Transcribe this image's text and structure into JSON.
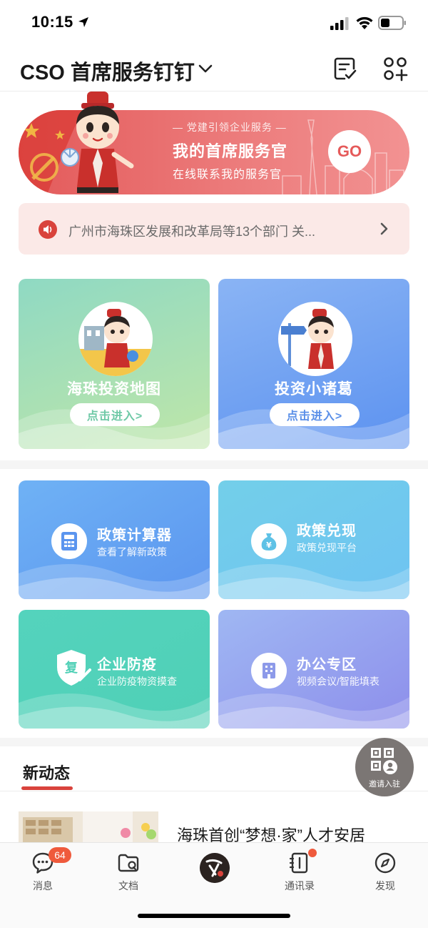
{
  "status_bar": {
    "time": "10:15"
  },
  "header": {
    "org_name": "CSO 首席服务钉钉"
  },
  "banner": {
    "subtitle": "— 党建引领企业服务 —",
    "title": "我的首席服务官",
    "description": "在线联系我的服务官",
    "go_label": "GO"
  },
  "notice": {
    "text": "广州市海珠区发展和改革局等13个部门 关..."
  },
  "feature_cards": [
    {
      "title": "海珠投资地图",
      "button": "点击进入>"
    },
    {
      "title": "投资小诸葛",
      "button": "点击进入>"
    }
  ],
  "service_cards": [
    {
      "title": "政策计算器",
      "subtitle": "查看了解新政策",
      "icon": "calculator-icon"
    },
    {
      "title": "政策兑现",
      "subtitle": "政策兑现平台",
      "icon": "money-bag-icon"
    },
    {
      "title": "企业防疫",
      "subtitle": "企业防疫物资摸查",
      "icon": "shield-icon",
      "icon_text": "复"
    },
    {
      "title": "办公专区",
      "subtitle": "视频会议/智能填表",
      "icon": "building-icon"
    }
  ],
  "news": {
    "tab": "新动态",
    "items": [
      {
        "title": "海珠首创“梦想·家”人才安居"
      }
    ]
  },
  "invite": {
    "label": "邀请入驻"
  },
  "tab_bar": {
    "items": [
      {
        "label": "消息",
        "badge": "64",
        "icon": "chat-icon"
      },
      {
        "label": "文档",
        "icon": "folder-icon"
      },
      {
        "label": "",
        "icon": "home-logo"
      },
      {
        "label": "通讯录",
        "icon": "contacts-icon"
      },
      {
        "label": "发现",
        "icon": "compass-icon"
      }
    ]
  },
  "colors": {
    "brand_red": "#d9433c",
    "badge": "#ef5a3c",
    "banner": "#e86565"
  }
}
